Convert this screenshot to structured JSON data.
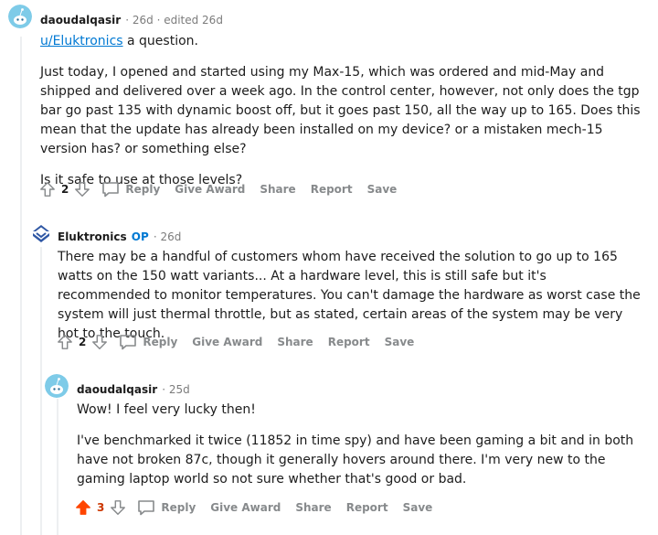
{
  "comments": [
    {
      "username": "daoudalqasir",
      "meta": "· 26d · edited 26d",
      "mention": "u/Eluktronics",
      "mention_suffix": " a question.",
      "para1": "Just today, I opened and started using my Max-15, which was ordered and mid-May and shipped and delivered over a week ago. In the control center, however, not only does the tgp bar go past 135 with dynamic boost off, but it goes past 150, all the way up to 165. Does this mean that the update has already been installed on my device? or a mistaken mech-15 version has? or something else?",
      "para2": "Is it safe to use at those levels?",
      "score": "2",
      "actions": {
        "reply": "Reply",
        "award": "Give Award",
        "share": "Share",
        "report": "Report",
        "save": "Save"
      }
    },
    {
      "username": "Eluktronics",
      "op": "OP",
      "meta": "· 26d",
      "para1": "There may be a handful of customers whom have received the solution to go up to 165 watts on the 150 watt variants... At a hardware level, this is still safe but it's recommended to monitor temperatures. You can't damage the hardware as worst case the system will just thermal throttle, but as stated, certain areas of the system may be very hot to the touch.",
      "score": "2",
      "actions": {
        "reply": "Reply",
        "award": "Give Award",
        "share": "Share",
        "report": "Report",
        "save": "Save"
      }
    },
    {
      "username": "daoudalqasir",
      "meta": "· 25d",
      "para1": "Wow! I feel very lucky then!",
      "para2": "I've benchmarked it twice (11852 in time spy) and have been gaming a bit and in both have not broken 87c, though it generally hovers around there. I'm very new to the gaming laptop world so not sure whether that's good or bad.",
      "score": "3",
      "actions": {
        "reply": "Reply",
        "award": "Give Award",
        "share": "Share",
        "report": "Report",
        "save": "Save"
      }
    }
  ],
  "colors": {
    "upvoted": "#ff4500",
    "link": "#0079d3",
    "meta": "#7c7c7c",
    "action": "#878a8c"
  }
}
